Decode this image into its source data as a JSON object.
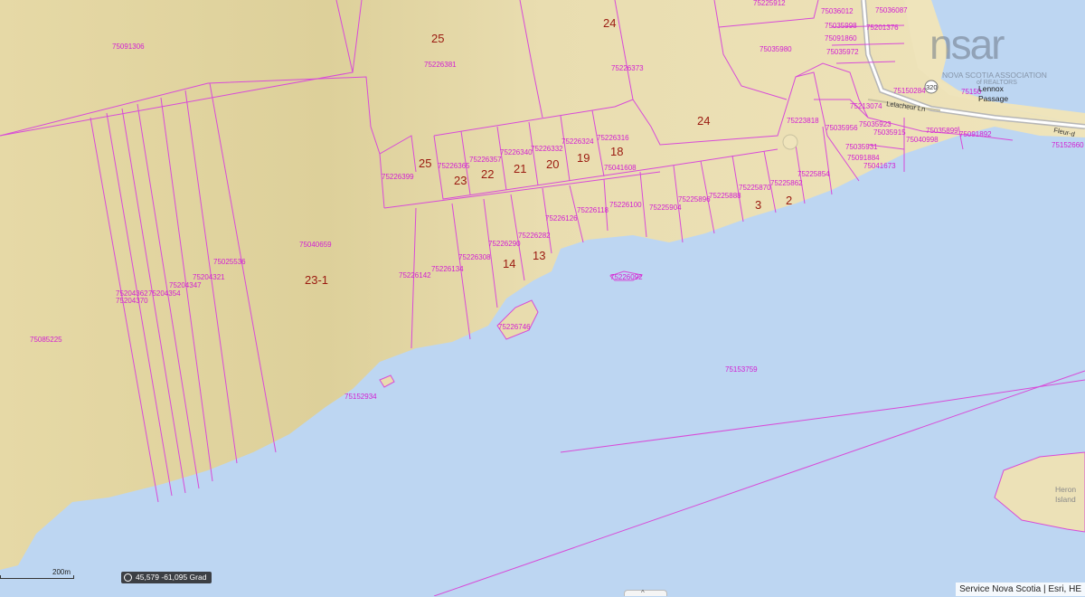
{
  "map": {
    "lot_numbers": [
      "25",
      "24",
      "24",
      "25",
      "23",
      "22",
      "21",
      "20",
      "19",
      "18",
      "23-1",
      "14",
      "13",
      "3",
      "2"
    ],
    "parcel_ids": [
      "75091306",
      "75226381",
      "75226373",
      "75225912",
      "75036012",
      "75036087",
      "75035998",
      "75091860",
      "75035972",
      "75035980",
      "75201376",
      "75150284",
      "75223818",
      "75213074",
      "75035923",
      "75035956",
      "75035915",
      "75040998",
      "75035899",
      "75091892",
      "75035931",
      "75091884",
      "75041673",
      "75152660",
      "75226365",
      "75226357",
      "75226340",
      "75226332",
      "75226324",
      "75226316",
      "75226399",
      "75041608",
      "75225854",
      "75225862",
      "75225870",
      "75225888",
      "75225896",
      "75225904",
      "75226100",
      "75226118",
      "75226126",
      "75226282",
      "75226290",
      "75226308",
      "75040659",
      "75025536",
      "75204321",
      "75204347",
      "75204362",
      "75204354",
      "75204370",
      "75226134",
      "75226142",
      "75226092",
      "75226746",
      "75085225",
      "75153759",
      "75152934",
      "75150"
    ],
    "places": [
      "Lennox",
      "Passage",
      "Heron",
      "Island"
    ],
    "roads": [
      "Lelacheur Ln",
      "Fleur-d",
      "320"
    ]
  },
  "logo": {
    "wordmark": "nsar",
    "line1": "NOVA SCOTIA ASSOCIATION",
    "line2": "of REALTORS"
  },
  "scale": {
    "label": "200m"
  },
  "coordinates": {
    "text": "45,579 -61,095 Grad"
  },
  "attribution": {
    "text": "Service Nova Scotia | Esri, HE"
  },
  "handle": {
    "glyph": "^"
  },
  "colors": {
    "water": "#bdd6f2",
    "land": "#ede2b8",
    "parcel_line": "#d84bd8",
    "parcel_id": "#d21fd2",
    "lot_number": "#9a1a10"
  }
}
